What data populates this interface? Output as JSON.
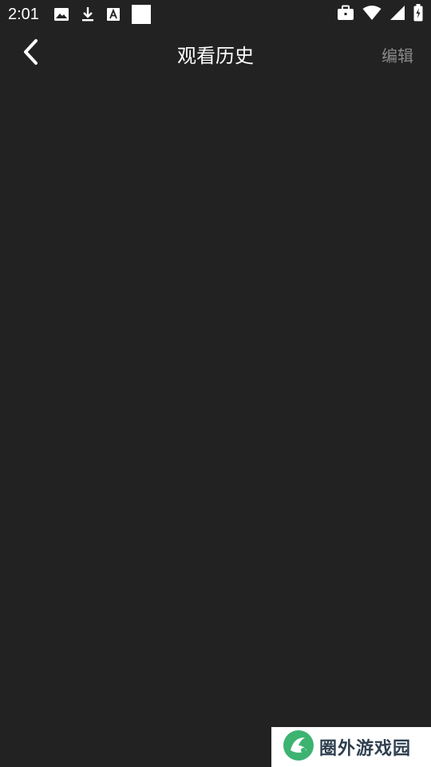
{
  "status_bar": {
    "time": "2:01",
    "left_icons": [
      "image-icon",
      "download-icon",
      "font-a-icon",
      "white-square-icon"
    ],
    "right_icons": [
      "briefcase-icon",
      "wifi-icon",
      "signal-icon",
      "battery-charging-icon"
    ]
  },
  "header": {
    "title": "观看历史",
    "edit_label": "编辑",
    "back_icon": "chevron-left-icon"
  },
  "watermark": {
    "text": "圈外游戏园",
    "logo_icon": "leaf-logo-icon",
    "brand_color": "#3cb371"
  },
  "colors": {
    "background": "#222222",
    "title": "#ffffff",
    "edit": "#8a8a8a"
  }
}
